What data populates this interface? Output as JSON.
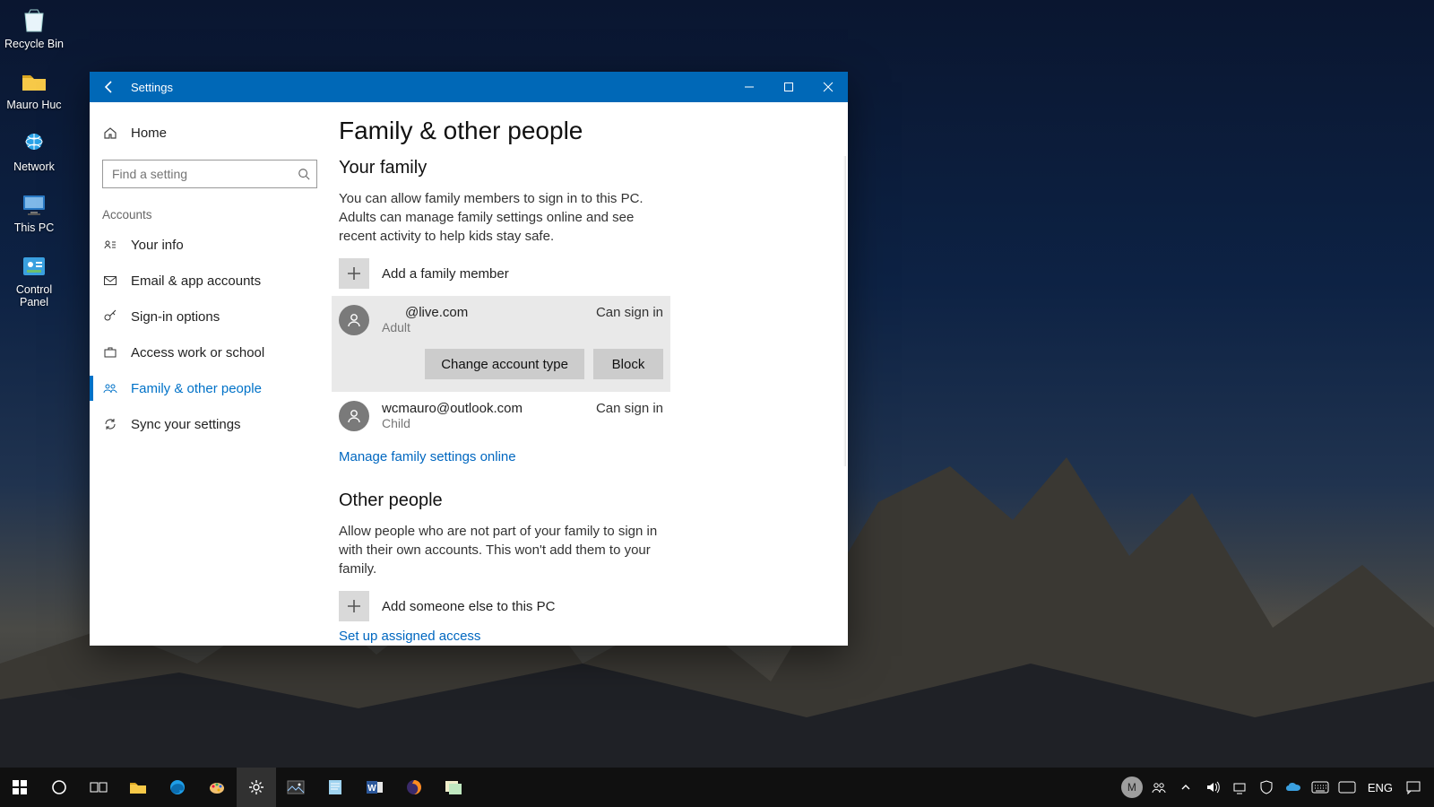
{
  "desktop": {
    "icons": [
      {
        "label": "Recycle Bin"
      },
      {
        "label": "Mauro Huc"
      },
      {
        "label": "Network"
      },
      {
        "label": "This PC"
      },
      {
        "label": "Control Panel"
      }
    ]
  },
  "window": {
    "title": "Settings",
    "home": "Home",
    "search_placeholder": "Find a setting",
    "category": "Accounts",
    "nav": [
      {
        "label": "Your info"
      },
      {
        "label": "Email & app accounts"
      },
      {
        "label": "Sign-in options"
      },
      {
        "label": "Access work or school"
      },
      {
        "label": "Family & other people"
      },
      {
        "label": "Sync your settings"
      }
    ]
  },
  "page": {
    "title": "Family & other people",
    "family": {
      "heading": "Your family",
      "description": "You can allow family members to sign in to this PC. Adults can manage family settings online and see recent activity to help kids stay safe.",
      "add_label": "Add a family member",
      "members": [
        {
          "email": "@live.com",
          "role": "Adult",
          "status": "Can sign in"
        },
        {
          "email": "wcmauro@outlook.com",
          "role": "Child",
          "status": "Can sign in"
        }
      ],
      "change_btn": "Change account type",
      "block_btn": "Block",
      "manage_link": "Manage family settings online"
    },
    "other": {
      "heading": "Other people",
      "description": "Allow people who are not part of your family to sign in with their own accounts. This won't add them to your family.",
      "add_label": "Add someone else to this PC",
      "assigned_link": "Set up assigned access"
    }
  },
  "taskbar": {
    "lang": "ENG",
    "time": "",
    "avatar_initial": "M"
  }
}
